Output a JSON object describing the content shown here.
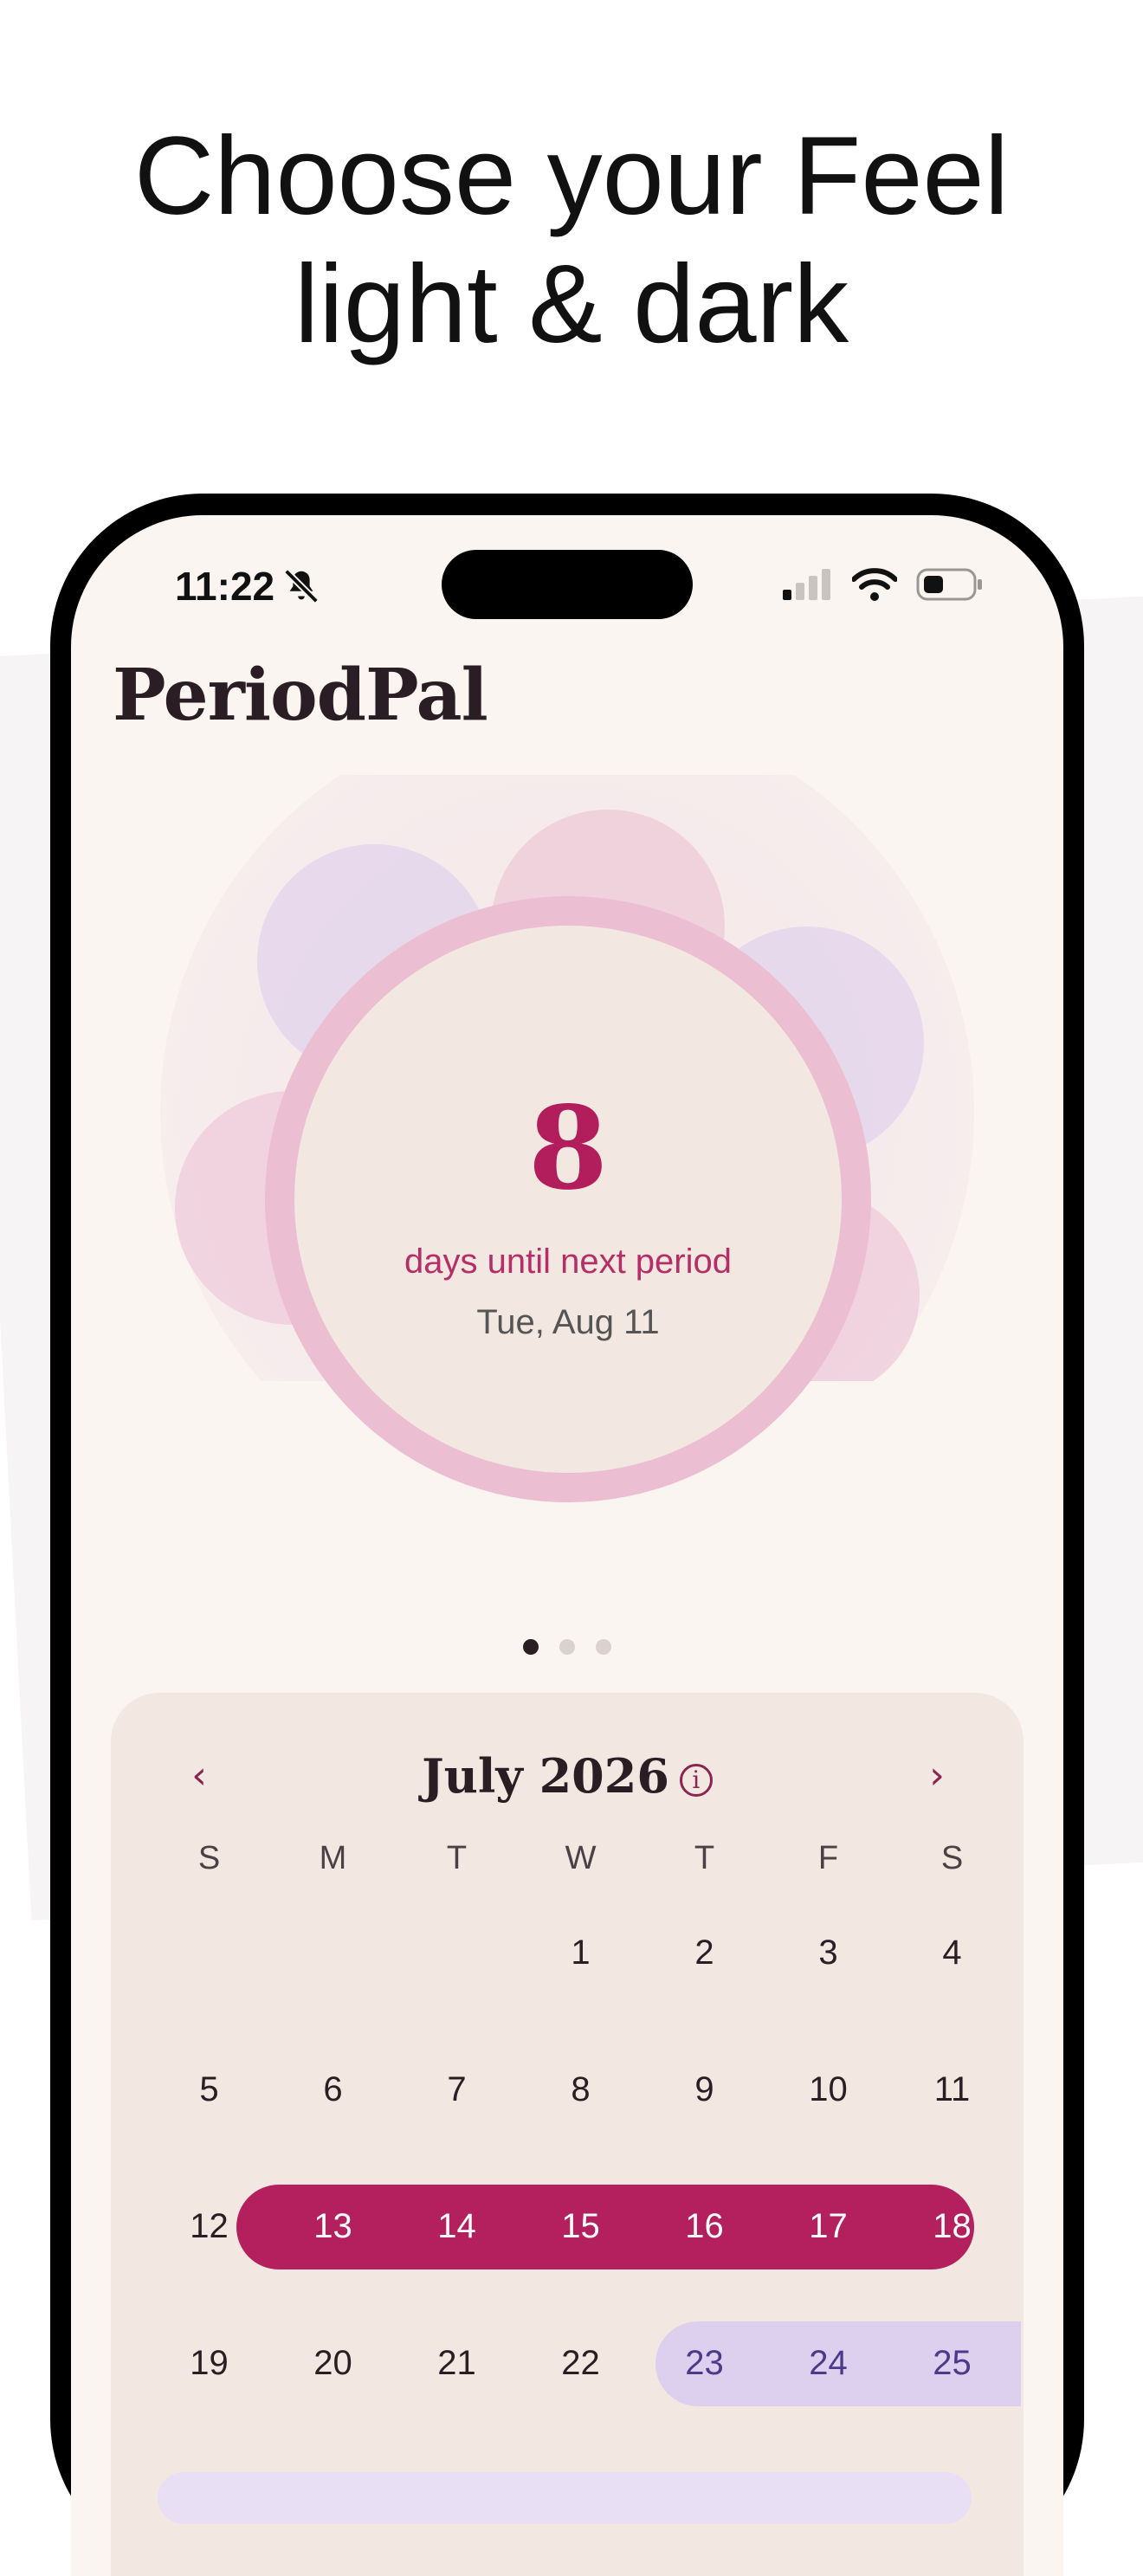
{
  "headline": {
    "line1": "Choose your Feel",
    "line2": "light & dark"
  },
  "status_bar": {
    "time": "11:22"
  },
  "app": {
    "title": "PeriodPal"
  },
  "countdown": {
    "days": "8",
    "label": "days until next period",
    "date": "Tue, Aug 11"
  },
  "pager": {
    "pages": 3,
    "active": 0
  },
  "calendar": {
    "month": "July 2026",
    "prev": "‹",
    "next": "›",
    "weekdays": [
      "S",
      "M",
      "T",
      "W",
      "T",
      "F",
      "S"
    ],
    "weeks": [
      [
        "",
        "",
        "",
        "1",
        "2",
        "3",
        "4"
      ],
      [
        "5",
        "6",
        "7",
        "8",
        "9",
        "10",
        "11"
      ],
      [
        "12",
        "13",
        "14",
        "15",
        "16",
        "17",
        "18"
      ],
      [
        "19",
        "20",
        "21",
        "22",
        "23",
        "24",
        "25"
      ]
    ],
    "period_days": [
      "13",
      "14",
      "15",
      "16",
      "17",
      "18"
    ],
    "fertile_days": [
      "23",
      "24",
      "25"
    ]
  },
  "colors": {
    "accent": "#b3205d",
    "fertile": "#dcd0ee",
    "background": "#faf5f0"
  }
}
